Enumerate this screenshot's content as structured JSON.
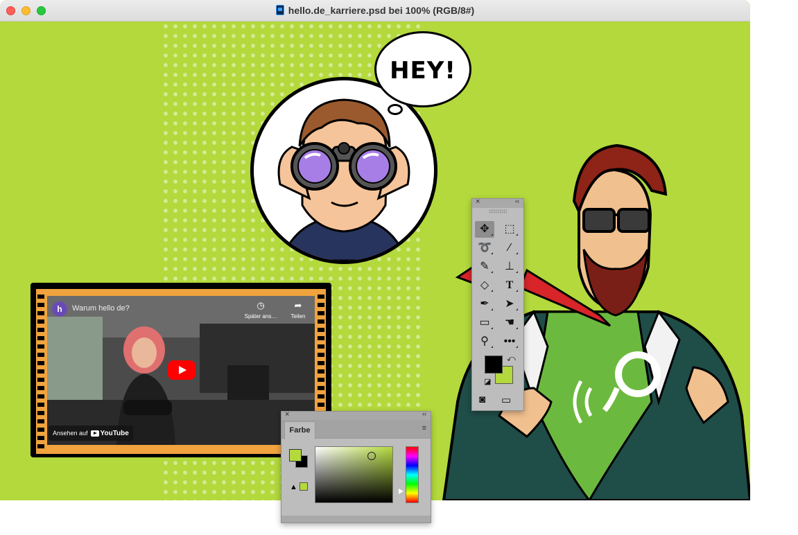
{
  "window": {
    "title": "hello.de_karriere.psd bei 100% (RGB/8#)",
    "traffic_lights": [
      "close",
      "minimize",
      "zoom"
    ],
    "canvas_color": "#b3d93c"
  },
  "comic": {
    "speech_bubble": "HEY!"
  },
  "video": {
    "channel_initial": "h",
    "title": "Warum hello de?",
    "watch_later": "Später ans…",
    "share": "Teilen",
    "watch_on": "Ansehen auf",
    "platform": "YouTube"
  },
  "color_panel": {
    "tab": "Farbe",
    "foreground_color": "#b3d93c",
    "background_color": "#000000"
  },
  "tools_panel": {
    "foreground_color": "#000000",
    "background_color": "#b3d93c",
    "tools": [
      "move",
      "rectangular-marquee",
      "lasso",
      "magic-wand",
      "brush",
      "clone-stamp",
      "eraser",
      "type",
      "pen",
      "path-selection",
      "rectangle",
      "hand",
      "zoom",
      "more"
    ],
    "selected_tool": "move"
  }
}
